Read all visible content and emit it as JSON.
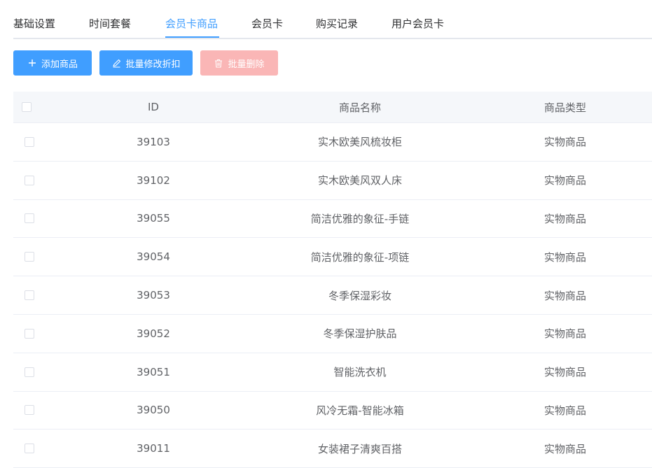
{
  "tabs": [
    {
      "label": "基础设置",
      "active": false
    },
    {
      "label": "时间套餐",
      "active": false
    },
    {
      "label": "会员卡商品",
      "active": true
    },
    {
      "label": "会员卡",
      "active": false
    },
    {
      "label": "购买记录",
      "active": false
    },
    {
      "label": "用户会员卡",
      "active": false
    }
  ],
  "toolbar": {
    "add_label": "添加商品",
    "batch_edit_label": "批量修改折扣",
    "batch_delete_label": "批量删除"
  },
  "table": {
    "columns": [
      "ID",
      "商品名称",
      "商品类型"
    ],
    "rows": [
      {
        "id": "39103",
        "name": "实木欧美风梳妆柜",
        "type": "实物商品"
      },
      {
        "id": "39102",
        "name": "实木欧美风双人床",
        "type": "实物商品"
      },
      {
        "id": "39055",
        "name": "简洁优雅的象征-手链",
        "type": "实物商品"
      },
      {
        "id": "39054",
        "name": "简洁优雅的象征-项链",
        "type": "实物商品"
      },
      {
        "id": "39053",
        "name": "冬季保湿彩妆",
        "type": "实物商品"
      },
      {
        "id": "39052",
        "name": "冬季保湿护肤品",
        "type": "实物商品"
      },
      {
        "id": "39051",
        "name": "智能洗衣机",
        "type": "实物商品"
      },
      {
        "id": "39050",
        "name": "风冷无霜-智能冰箱",
        "type": "实物商品"
      },
      {
        "id": "39011",
        "name": "女装裙子清爽百搭",
        "type": "实物商品"
      }
    ]
  },
  "icons": {
    "add": "plus-icon",
    "edit": "edit-icon",
    "delete": "trash-icon"
  },
  "colors": {
    "primary": "#409eff",
    "danger_disabled": "#fab6b6",
    "header_bg": "#f5f7fa"
  }
}
